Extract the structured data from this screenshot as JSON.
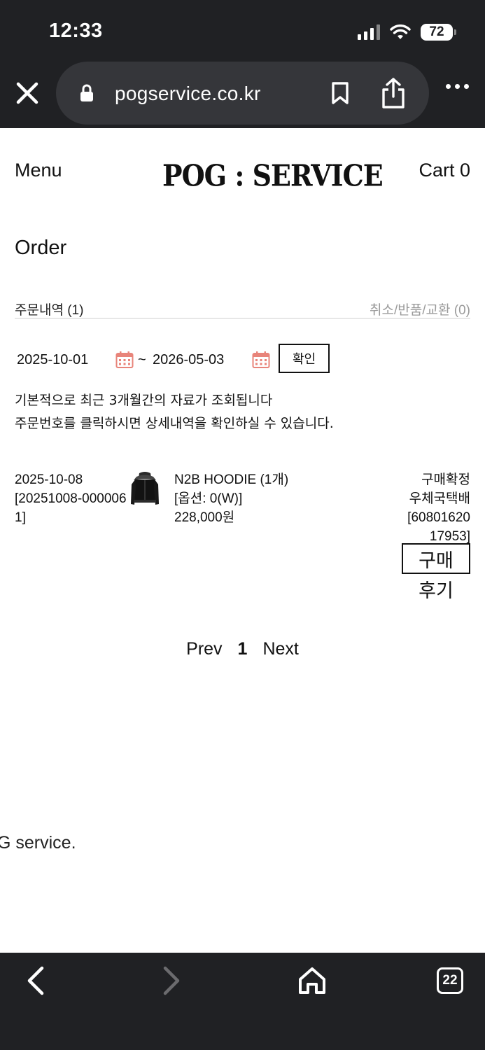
{
  "status_bar": {
    "time": "12:33",
    "battery": "72"
  },
  "browser": {
    "url": "pogservice.co.kr",
    "tab_count": "22"
  },
  "header": {
    "menu_label": "Menu",
    "logo_text": "POG : SERVICE",
    "cart_label": "Cart 0"
  },
  "page": {
    "title": "Order"
  },
  "tabs": {
    "orders_label": "주문내역 (1)",
    "cancel_label": "취소/반품/교환 (0)"
  },
  "date_filter": {
    "from": "2025-10-01",
    "separator": "~",
    "to": "2026-05-03",
    "confirm_label": "확인"
  },
  "notice": {
    "line1": "기본적으로 최근 3개월간의 자료가 조회됩니다",
    "line2": "주문번호를 클릭하시면 상세내역을 확인하실 수 있습니다."
  },
  "orders": [
    {
      "date": "2025-10-08",
      "order_number": "[20251008-0000061]",
      "product_name": "N2B HOODIE (1개)",
      "option": "[옵션: 0(W)]",
      "price": "228,000원",
      "status": "구매확정",
      "carrier": "우체국택배",
      "tracking": "[6080162017953]",
      "review_label_1": "구매",
      "review_label_2": "후기"
    }
  ],
  "pagination": {
    "prev": "Prev",
    "current": "1",
    "next": "Next"
  },
  "footer": {
    "text": "G service."
  },
  "colors": {
    "chrome_bg": "#202124",
    "url_pill_bg": "#35363a",
    "calendar_icon": "#e8847a",
    "muted_text": "#9a9a9a"
  }
}
